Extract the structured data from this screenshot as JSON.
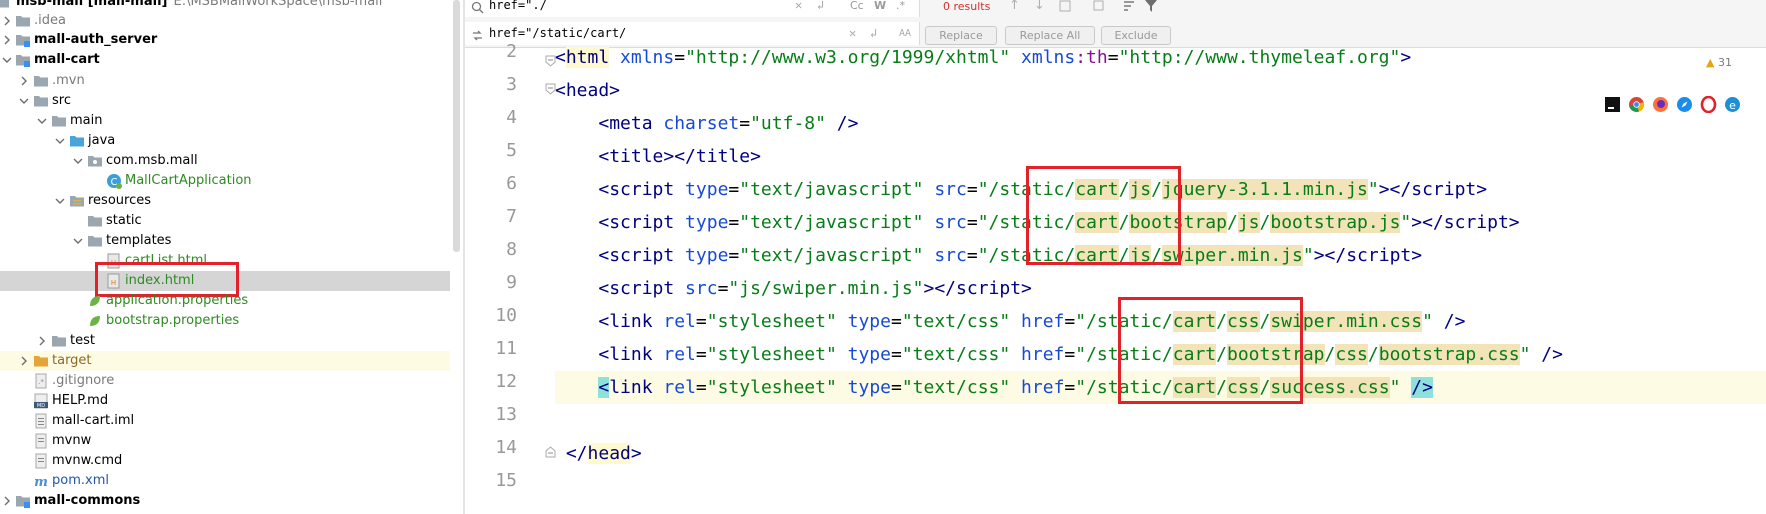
{
  "tree": {
    "root_label": "msb-mall [mall-mall]",
    "root_path": "E:\\MSBMallWorkSpace\\msb-mall",
    "items": [
      {
        "label": ".idea"
      },
      {
        "label": "mall-auth_server"
      },
      {
        "label": "mall-cart"
      },
      {
        "label": ".mvn"
      },
      {
        "label": "src"
      },
      {
        "label": "main"
      },
      {
        "label": "java"
      },
      {
        "label": "com.msb.mall"
      },
      {
        "label": "MallCartApplication"
      },
      {
        "label": "resources"
      },
      {
        "label": "static"
      },
      {
        "label": "templates"
      },
      {
        "label": "cartList.html"
      },
      {
        "label": "index.html"
      },
      {
        "label": "application.properties"
      },
      {
        "label": "bootstrap.properties"
      },
      {
        "label": "test"
      },
      {
        "label": "target"
      },
      {
        "label": ".gitignore"
      },
      {
        "label": "HELP.md"
      },
      {
        "label": "mall-cart.iml"
      },
      {
        "label": "mvnw"
      },
      {
        "label": "mvnw.cmd"
      },
      {
        "label": "pom.xml"
      },
      {
        "label": "mall-commons"
      }
    ]
  },
  "find": {
    "search_value": "href=\"./",
    "replace_value": "href=\"/static/cart/",
    "results": "0 results",
    "tool_cc": "Cc",
    "tool_w": "W",
    "tool_regex": ".*",
    "tool_preserve": "AA",
    "replace_label": "Replace",
    "replace_all_label": "Replace All",
    "exclude_label": "Exclude"
  },
  "editor": {
    "line_numbers": [
      "2",
      "3",
      "4",
      "5",
      "6",
      "7",
      "8",
      "9",
      "10",
      "11",
      "12",
      "13",
      "14",
      "15"
    ],
    "warnings": "31",
    "lines": {
      "l2": {
        "t1": "<",
        "t2": "html",
        "a1": " xmlns",
        "eq1": "=",
        "v1": "\"http://www.w3.org/1999/xhtml\"",
        "a2": " xmlns",
        "ns": ":th",
        "eq2": "=",
        "v2": "\"http://www.thymeleaf.org\"",
        "t3": ">"
      },
      "l3": {
        "t1": "<head>"
      },
      "l4": {
        "ind": "    ",
        "t1": "<meta",
        "a1": " charset",
        "eq": "=",
        "v1": "\"utf-8\"",
        "t2": " />"
      },
      "l5": {
        "ind": "    ",
        "t1": "<title></title>"
      },
      "l6": {
        "ind": "    ",
        "t1": "<script",
        "a1": " type",
        "eq1": "=",
        "v1": "\"text/javascript\"",
        "a2": " src",
        "eq2": "=",
        "q": "\"",
        "p1": "/static/",
        "p2": "cart",
        "p3": "/",
        "p4": "js",
        "p5": "/",
        "p6": "jquery-3.1.1.min.js",
        "q2": "\"",
        "t2": "></",
        "t3": "script",
        "t4": ">"
      },
      "l7": {
        "ind": "    ",
        "t1": "<script",
        "a1": " type",
        "eq1": "=",
        "v1": "\"text/javascript\"",
        "a2": " src",
        "eq2": "=",
        "q": "\"",
        "p1": "/static/",
        "p2": "cart",
        "p3": "/",
        "p4": "bootstrap",
        "p5": "/",
        "p6": "js",
        "p7": "/",
        "p8": "bootstrap.js",
        "q2": "\"",
        "t2": "></",
        "t3": "script",
        "t4": ">"
      },
      "l8": {
        "ind": "    ",
        "t1": "<script",
        "a1": " type",
        "eq1": "=",
        "v1": "\"text/javascript\"",
        "a2": " src",
        "eq2": "=",
        "q": "\"",
        "p1": "/static/",
        "p2": "cart",
        "p3": "/",
        "p4": "js",
        "p5": "/",
        "p6": "swiper.min.js",
        "q2": "\"",
        "t2": "></",
        "t3": "script",
        "t4": ">"
      },
      "l9": {
        "ind": "    ",
        "t1": "<script",
        "a1": " src",
        "eq1": "=",
        "v1": "\"js/swiper.min.js\"",
        "t2": "></",
        "t3": "script",
        "t4": ">"
      },
      "l10": {
        "ind": "    ",
        "t1": "<link",
        "a1": " rel",
        "eq1": "=",
        "v1": "\"stylesheet\"",
        "a2": " type",
        "eq2": "=",
        "v2": "\"text/css\"",
        "a3": " href",
        "eq3": "=",
        "q": "\"",
        "p1": "/static/",
        "p2": "cart",
        "p3": "/",
        "p4": "css",
        "p5": "/",
        "p6": "swiper.min.css",
        "q2": "\"",
        "t2": " />"
      },
      "l11": {
        "ind": "    ",
        "t1": "<link",
        "a1": " rel",
        "eq1": "=",
        "v1": "\"stylesheet\"",
        "a2": " type",
        "eq2": "=",
        "v2": "\"text/css\"",
        "a3": " href",
        "eq3": "=",
        "q": "\"",
        "p1": "/static/",
        "p2": "cart",
        "p3": "/",
        "p4": "bootstrap",
        "p5": "/",
        "p6": "css",
        "p7": "/",
        "p8": "bootstrap.css",
        "q2": "\"",
        "t2": " />"
      },
      "l12": {
        "ind": "    ",
        "t1": "<",
        "t1b": "link",
        "a1": " rel",
        "eq1": "=",
        "v1": "\"stylesheet\"",
        "a2": " type",
        "eq2": "=",
        "v2": "\"text/css\"",
        "a3": " href",
        "eq3": "=",
        "q": "\"",
        "p1": "/static/",
        "p2": "cart",
        "p3": "/",
        "p4": "css",
        "p5": "/",
        "p6": "success.css",
        "q2": "\"",
        "sp": " ",
        "t2": "/>"
      },
      "l14": {
        "ind": " ",
        "t1": "</",
        "t2": "head",
        "t3": ">"
      }
    }
  },
  "colors": {
    "selection": "#d5d5d5",
    "current_line": "#fdfbe3",
    "annotation_red": "#e2222b",
    "tag": "#000080",
    "attribute": "#174ad4",
    "value": "#067d17",
    "namespace": "#871094",
    "results_red": "#d0312d"
  },
  "icons": {
    "browsers": [
      "intellij-icon",
      "chrome-icon",
      "firefox-icon",
      "safari-icon",
      "opera-icon",
      "edge-icon"
    ]
  }
}
